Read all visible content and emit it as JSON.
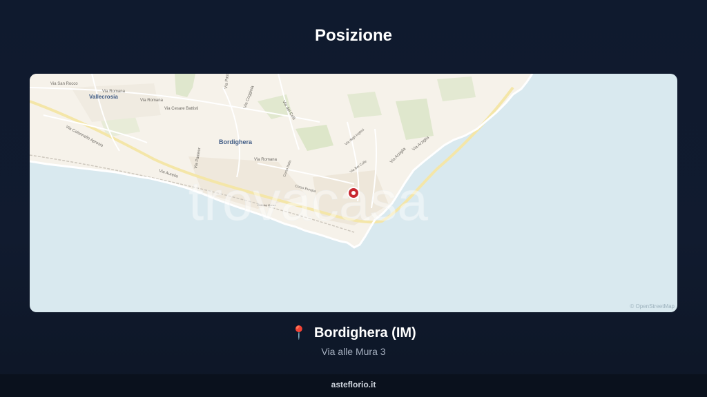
{
  "header": {
    "title": "Posizione"
  },
  "map": {
    "watermark": "trovacasa",
    "attribution": "© OpenStreetMap",
    "town_labels": {
      "vallecrosia": "Vallecrosia",
      "bordighera": "Bordighera"
    },
    "street_labels": {
      "san_rocco": "Via San Rocco",
      "romana_1": "Via Romana",
      "romana_2": "Via Romana",
      "romana_3": "Via Romana",
      "cesare_battisti": "Via Cesare Battisti",
      "coggiola": "Via Coggiola",
      "dei_colli": "Via dei Colli",
      "passo": "Via Passo",
      "colonnello_aprosio": "Via Colonnello Aprosio",
      "pasteur": "Via Pasteur",
      "aurelia": "Via Aurelia",
      "corso_italia": "Corso Italia",
      "corso_europa": "Corso Europa",
      "giardini": "Giardini Monet",
      "degli_inglesi": "Via degli Inglesi",
      "bel_colle": "Via Bel Colle",
      "arziglia_1": "Via Arziglia",
      "arziglia_2": "Via Arziglia"
    },
    "marker_icon": "location-marker-icon",
    "colors": {
      "sea": "#d9e9ef",
      "land": "#f5f1ea",
      "marker": "#c8272f"
    }
  },
  "location": {
    "pin_icon": "pin-icon",
    "pin_glyph": "📍",
    "city": "Bordighera (IM)",
    "address": "Via alle Mura 3"
  },
  "footer": {
    "site": "asteflorio.it"
  }
}
